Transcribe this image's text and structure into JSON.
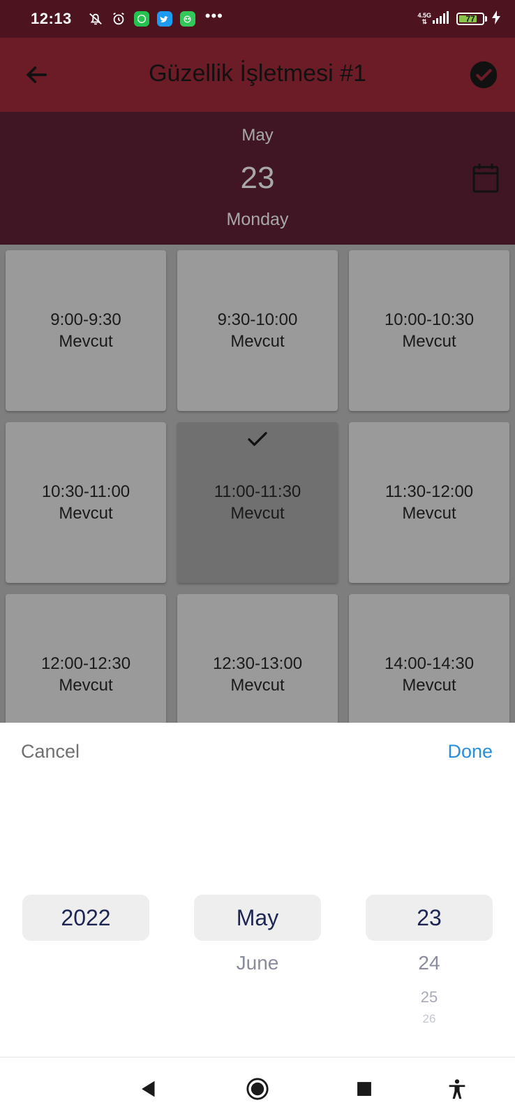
{
  "status_bar": {
    "time": "12:13",
    "network": "4.5G",
    "battery": "77",
    "app_icons": [
      "mute-icon",
      "alarm-icon",
      "whatsapp-icon",
      "twitter-icon",
      "app-icon"
    ],
    "more": "•••"
  },
  "app_bar": {
    "title": "Güzellik İşletmesi #1"
  },
  "date_header": {
    "month": "May",
    "day": "23",
    "weekday": "Monday"
  },
  "slots": [
    {
      "time": "9:00-9:30",
      "status": "Mevcut",
      "selected": false
    },
    {
      "time": "9:30-10:00",
      "status": "Mevcut",
      "selected": false
    },
    {
      "time": "10:00-10:30",
      "status": "Mevcut",
      "selected": false
    },
    {
      "time": "10:30-11:00",
      "status": "Mevcut",
      "selected": false
    },
    {
      "time": "11:00-11:30",
      "status": "Mevcut",
      "selected": true
    },
    {
      "time": "11:30-12:00",
      "status": "Mevcut",
      "selected": false
    },
    {
      "time": "12:00-12:30",
      "status": "Mevcut",
      "selected": false
    },
    {
      "time": "12:30-13:00",
      "status": "Mevcut",
      "selected": false
    },
    {
      "time": "14:00-14:30",
      "status": "Mevcut",
      "selected": false
    }
  ],
  "picker": {
    "cancel_label": "Cancel",
    "done_label": "Done",
    "year": {
      "selected": "2022"
    },
    "month": {
      "selected": "May",
      "next": [
        "June"
      ]
    },
    "day": {
      "selected": "23",
      "next": [
        "24",
        "25",
        "26"
      ]
    }
  },
  "colors": {
    "status_bar": "#4d1420",
    "app_bar": "#6b1c27",
    "date_header": "#411624",
    "done": "#2a8fd6"
  }
}
